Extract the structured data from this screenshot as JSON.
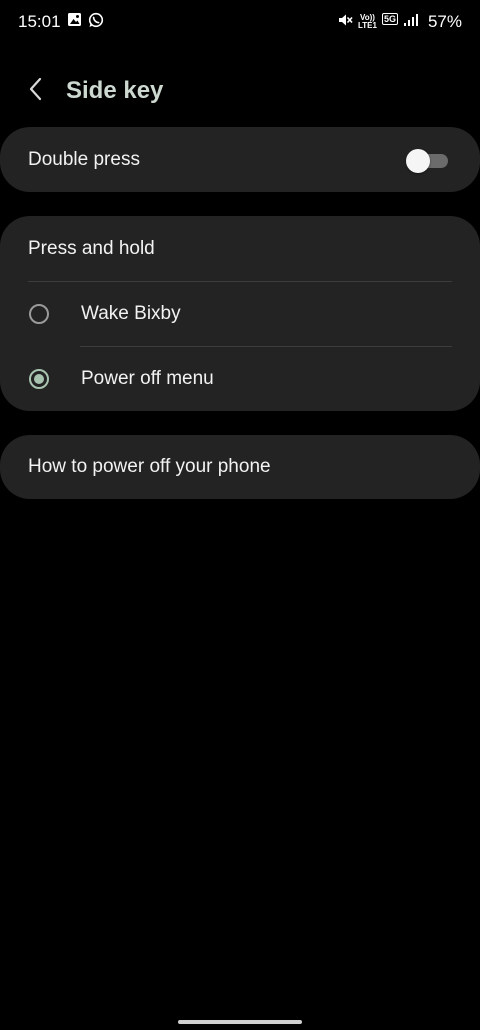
{
  "status_bar": {
    "time": "15:01",
    "volte_label": "Vo))",
    "lte_label": "LTE1",
    "network_label": "5G",
    "battery": "57%"
  },
  "header": {
    "title": "Side key"
  },
  "double_press": {
    "label": "Double press",
    "enabled": false
  },
  "press_and_hold": {
    "heading": "Press and hold",
    "options": [
      {
        "label": "Wake Bixby",
        "selected": false
      },
      {
        "label": "Power off menu",
        "selected": true
      }
    ]
  },
  "help": {
    "label": "How to power off your phone"
  },
  "colors": {
    "accent": "#a8c3b0",
    "card_bg": "#232323",
    "background": "#000000"
  },
  "icons": {
    "status": [
      "gallery-icon",
      "whatsapp-icon",
      "mute-icon",
      "signal-icon"
    ],
    "header": "chevron-left-icon"
  }
}
